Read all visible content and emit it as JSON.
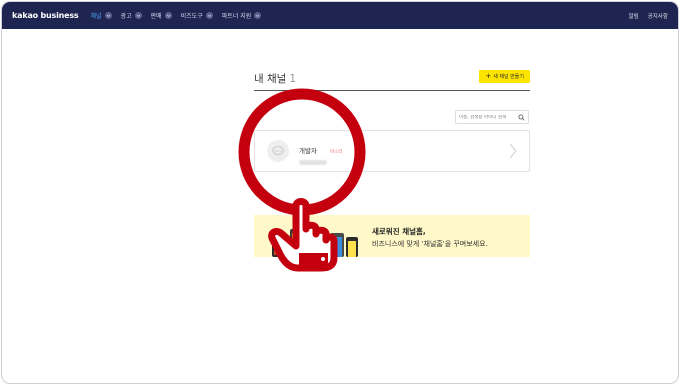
{
  "header": {
    "logo": "kakao business",
    "nav": [
      {
        "label": "채널"
      },
      {
        "label": "광고"
      },
      {
        "label": "판매"
      },
      {
        "label": "비즈도구"
      },
      {
        "label": "파트너 지원"
      }
    ],
    "right_links": [
      "알림",
      "공지사항"
    ]
  },
  "main": {
    "title": "내 채널",
    "count": "1",
    "create_button": "새 채널 만들기",
    "search_placeholder": "이름, 검색용 아이디 검색",
    "channel": {
      "name": "개발자",
      "role": "마스터"
    }
  },
  "banner": {
    "title": "새로워진 채널홈,",
    "description": "비즈니스에 맞게 '채널홈'을 꾸며보세요."
  },
  "colors": {
    "topbar": "#1e2550",
    "accent_nav": "#4ea4ff",
    "button_yellow": "#fee500",
    "banner_bg": "#fff9c9",
    "highlight_red": "#c4000e",
    "role_text": "#f06a6a"
  }
}
